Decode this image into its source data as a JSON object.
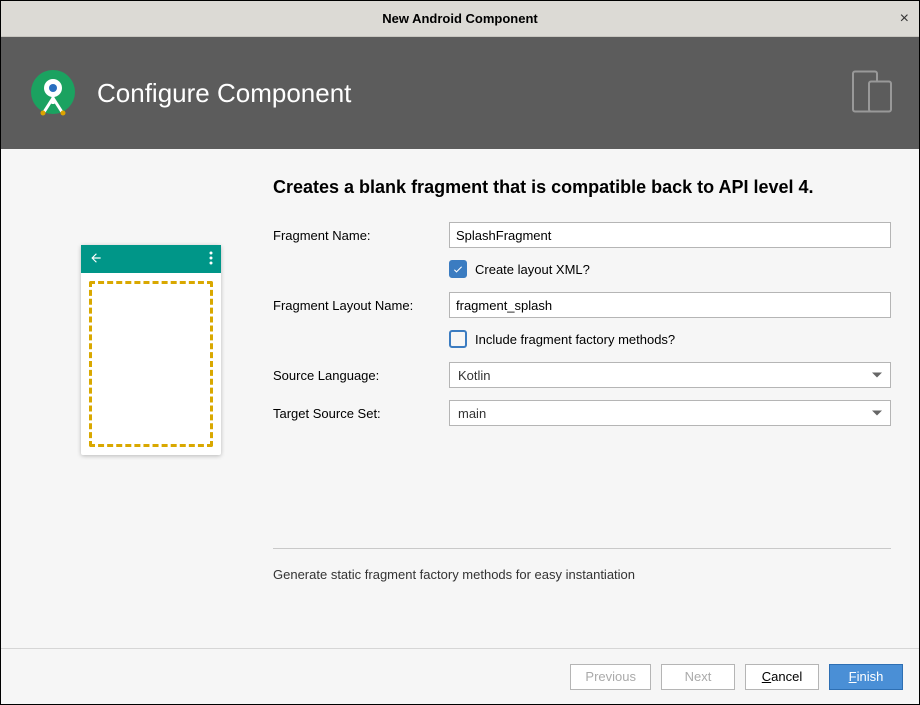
{
  "window": {
    "title": "New Android Component"
  },
  "header": {
    "title": "Configure Component"
  },
  "description": "Creates a blank fragment that is compatible back to API level 4.",
  "form": {
    "fragment_name": {
      "label": "Fragment Name:",
      "value": "SplashFragment"
    },
    "create_layout": {
      "label": "Create layout XML?",
      "checked": true
    },
    "layout_name": {
      "label": "Fragment Layout Name:",
      "value": "fragment_splash"
    },
    "include_factory": {
      "label": "Include fragment factory methods?",
      "checked": false
    },
    "source_language": {
      "label": "Source Language:",
      "value": "Kotlin"
    },
    "target_source_set": {
      "label": "Target Source Set:",
      "value": "main"
    }
  },
  "helper": "Generate static fragment factory methods for easy instantiation",
  "footer": {
    "previous": "Previous",
    "next": "Next",
    "cancel": "Cancel",
    "finish": "Finish"
  }
}
